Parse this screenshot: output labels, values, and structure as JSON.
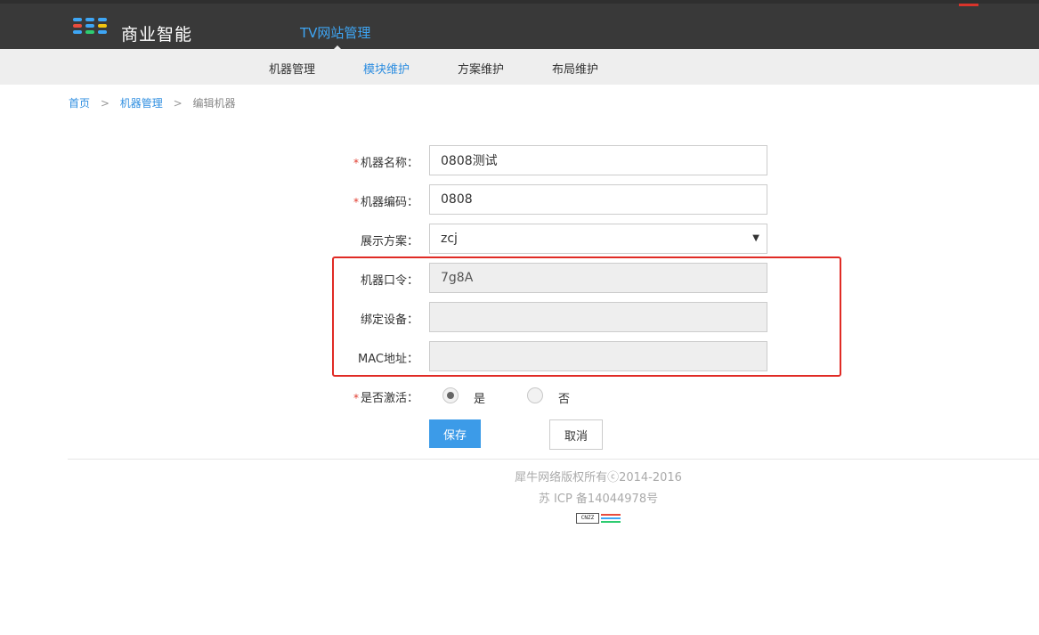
{
  "header": {
    "brand": "商业智能",
    "nav_tv": "TV网站管理"
  },
  "subnav": {
    "items": [
      {
        "label": "机器管理",
        "active": false
      },
      {
        "label": "模块维护",
        "active": true
      },
      {
        "label": "方案维护",
        "active": false
      },
      {
        "label": "布局维护",
        "active": false
      }
    ]
  },
  "breadcrumb": {
    "home": "首页",
    "sep": ">",
    "section": "机器管理",
    "current": "编辑机器"
  },
  "form": {
    "required_mark": "*",
    "name_label": "机器名称：",
    "name_value": "0808测试",
    "code_label": "机器编码：",
    "code_value": "0808",
    "scheme_label": "展示方案：",
    "scheme_value": "zcj",
    "token_label": "机器口令：",
    "token_value": "7g8A",
    "device_label": "绑定设备：",
    "device_value": "",
    "mac_label": "MAC地址：",
    "mac_value": "",
    "active_label": "是否激活：",
    "active_yes": "是",
    "active_no": "否",
    "active_selected": "是",
    "save_label": "保存",
    "cancel_label": "取消"
  },
  "footer": {
    "copyright": "犀牛网络版权所有ⓒ2014-2016",
    "icp": "苏 ICP 备14044978号",
    "badge_text": "CNZZ"
  },
  "colors": {
    "accent": "#3c9be8",
    "topbar": "#393939",
    "highlight": "#e02b25"
  }
}
